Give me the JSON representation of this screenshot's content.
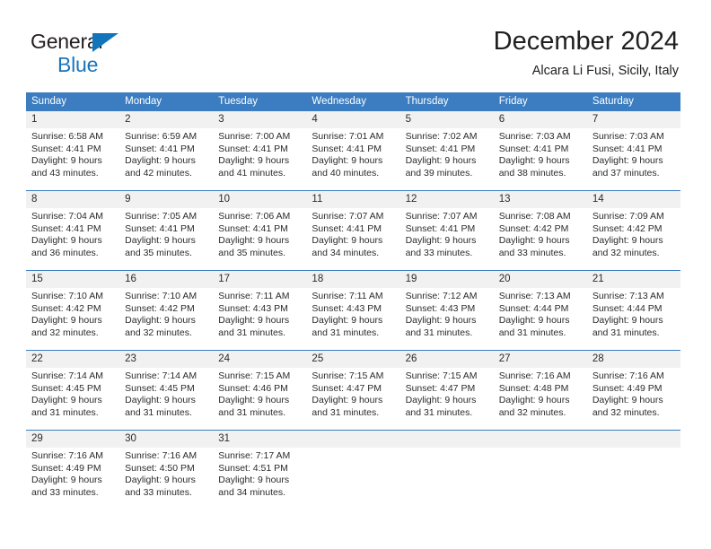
{
  "brand": {
    "name_part1": "General",
    "name_part2": "Blue",
    "color_dark": "#231f20",
    "color_blue": "#1b75bb"
  },
  "header": {
    "title": "December 2024",
    "subtitle": "Alcara Li Fusi, Sicily, Italy"
  },
  "calendar": {
    "accent_color": "#3b7dc0",
    "daynumber_band_color": "#f1f1f1",
    "day_headers": [
      "Sunday",
      "Monday",
      "Tuesday",
      "Wednesday",
      "Thursday",
      "Friday",
      "Saturday"
    ],
    "weeks": [
      {
        "days": [
          {
            "num": "1",
            "sunrise": "Sunrise: 6:58 AM",
            "sunset": "Sunset: 4:41 PM",
            "daylight_line1": "Daylight: 9 hours",
            "daylight_line2": "and 43 minutes."
          },
          {
            "num": "2",
            "sunrise": "Sunrise: 6:59 AM",
            "sunset": "Sunset: 4:41 PM",
            "daylight_line1": "Daylight: 9 hours",
            "daylight_line2": "and 42 minutes."
          },
          {
            "num": "3",
            "sunrise": "Sunrise: 7:00 AM",
            "sunset": "Sunset: 4:41 PM",
            "daylight_line1": "Daylight: 9 hours",
            "daylight_line2": "and 41 minutes."
          },
          {
            "num": "4",
            "sunrise": "Sunrise: 7:01 AM",
            "sunset": "Sunset: 4:41 PM",
            "daylight_line1": "Daylight: 9 hours",
            "daylight_line2": "and 40 minutes."
          },
          {
            "num": "5",
            "sunrise": "Sunrise: 7:02 AM",
            "sunset": "Sunset: 4:41 PM",
            "daylight_line1": "Daylight: 9 hours",
            "daylight_line2": "and 39 minutes."
          },
          {
            "num": "6",
            "sunrise": "Sunrise: 7:03 AM",
            "sunset": "Sunset: 4:41 PM",
            "daylight_line1": "Daylight: 9 hours",
            "daylight_line2": "and 38 minutes."
          },
          {
            "num": "7",
            "sunrise": "Sunrise: 7:03 AM",
            "sunset": "Sunset: 4:41 PM",
            "daylight_line1": "Daylight: 9 hours",
            "daylight_line2": "and 37 minutes."
          }
        ]
      },
      {
        "days": [
          {
            "num": "8",
            "sunrise": "Sunrise: 7:04 AM",
            "sunset": "Sunset: 4:41 PM",
            "daylight_line1": "Daylight: 9 hours",
            "daylight_line2": "and 36 minutes."
          },
          {
            "num": "9",
            "sunrise": "Sunrise: 7:05 AM",
            "sunset": "Sunset: 4:41 PM",
            "daylight_line1": "Daylight: 9 hours",
            "daylight_line2": "and 35 minutes."
          },
          {
            "num": "10",
            "sunrise": "Sunrise: 7:06 AM",
            "sunset": "Sunset: 4:41 PM",
            "daylight_line1": "Daylight: 9 hours",
            "daylight_line2": "and 35 minutes."
          },
          {
            "num": "11",
            "sunrise": "Sunrise: 7:07 AM",
            "sunset": "Sunset: 4:41 PM",
            "daylight_line1": "Daylight: 9 hours",
            "daylight_line2": "and 34 minutes."
          },
          {
            "num": "12",
            "sunrise": "Sunrise: 7:07 AM",
            "sunset": "Sunset: 4:41 PM",
            "daylight_line1": "Daylight: 9 hours",
            "daylight_line2": "and 33 minutes."
          },
          {
            "num": "13",
            "sunrise": "Sunrise: 7:08 AM",
            "sunset": "Sunset: 4:42 PM",
            "daylight_line1": "Daylight: 9 hours",
            "daylight_line2": "and 33 minutes."
          },
          {
            "num": "14",
            "sunrise": "Sunrise: 7:09 AM",
            "sunset": "Sunset: 4:42 PM",
            "daylight_line1": "Daylight: 9 hours",
            "daylight_line2": "and 32 minutes."
          }
        ]
      },
      {
        "days": [
          {
            "num": "15",
            "sunrise": "Sunrise: 7:10 AM",
            "sunset": "Sunset: 4:42 PM",
            "daylight_line1": "Daylight: 9 hours",
            "daylight_line2": "and 32 minutes."
          },
          {
            "num": "16",
            "sunrise": "Sunrise: 7:10 AM",
            "sunset": "Sunset: 4:42 PM",
            "daylight_line1": "Daylight: 9 hours",
            "daylight_line2": "and 32 minutes."
          },
          {
            "num": "17",
            "sunrise": "Sunrise: 7:11 AM",
            "sunset": "Sunset: 4:43 PM",
            "daylight_line1": "Daylight: 9 hours",
            "daylight_line2": "and 31 minutes."
          },
          {
            "num": "18",
            "sunrise": "Sunrise: 7:11 AM",
            "sunset": "Sunset: 4:43 PM",
            "daylight_line1": "Daylight: 9 hours",
            "daylight_line2": "and 31 minutes."
          },
          {
            "num": "19",
            "sunrise": "Sunrise: 7:12 AM",
            "sunset": "Sunset: 4:43 PM",
            "daylight_line1": "Daylight: 9 hours",
            "daylight_line2": "and 31 minutes."
          },
          {
            "num": "20",
            "sunrise": "Sunrise: 7:13 AM",
            "sunset": "Sunset: 4:44 PM",
            "daylight_line1": "Daylight: 9 hours",
            "daylight_line2": "and 31 minutes."
          },
          {
            "num": "21",
            "sunrise": "Sunrise: 7:13 AM",
            "sunset": "Sunset: 4:44 PM",
            "daylight_line1": "Daylight: 9 hours",
            "daylight_line2": "and 31 minutes."
          }
        ]
      },
      {
        "days": [
          {
            "num": "22",
            "sunrise": "Sunrise: 7:14 AM",
            "sunset": "Sunset: 4:45 PM",
            "daylight_line1": "Daylight: 9 hours",
            "daylight_line2": "and 31 minutes."
          },
          {
            "num": "23",
            "sunrise": "Sunrise: 7:14 AM",
            "sunset": "Sunset: 4:45 PM",
            "daylight_line1": "Daylight: 9 hours",
            "daylight_line2": "and 31 minutes."
          },
          {
            "num": "24",
            "sunrise": "Sunrise: 7:15 AM",
            "sunset": "Sunset: 4:46 PM",
            "daylight_line1": "Daylight: 9 hours",
            "daylight_line2": "and 31 minutes."
          },
          {
            "num": "25",
            "sunrise": "Sunrise: 7:15 AM",
            "sunset": "Sunset: 4:47 PM",
            "daylight_line1": "Daylight: 9 hours",
            "daylight_line2": "and 31 minutes."
          },
          {
            "num": "26",
            "sunrise": "Sunrise: 7:15 AM",
            "sunset": "Sunset: 4:47 PM",
            "daylight_line1": "Daylight: 9 hours",
            "daylight_line2": "and 31 minutes."
          },
          {
            "num": "27",
            "sunrise": "Sunrise: 7:16 AM",
            "sunset": "Sunset: 4:48 PM",
            "daylight_line1": "Daylight: 9 hours",
            "daylight_line2": "and 32 minutes."
          },
          {
            "num": "28",
            "sunrise": "Sunrise: 7:16 AM",
            "sunset": "Sunset: 4:49 PM",
            "daylight_line1": "Daylight: 9 hours",
            "daylight_line2": "and 32 minutes."
          }
        ]
      },
      {
        "days": [
          {
            "num": "29",
            "sunrise": "Sunrise: 7:16 AM",
            "sunset": "Sunset: 4:49 PM",
            "daylight_line1": "Daylight: 9 hours",
            "daylight_line2": "and 33 minutes."
          },
          {
            "num": "30",
            "sunrise": "Sunrise: 7:16 AM",
            "sunset": "Sunset: 4:50 PM",
            "daylight_line1": "Daylight: 9 hours",
            "daylight_line2": "and 33 minutes."
          },
          {
            "num": "31",
            "sunrise": "Sunrise: 7:17 AM",
            "sunset": "Sunset: 4:51 PM",
            "daylight_line1": "Daylight: 9 hours",
            "daylight_line2": "and 34 minutes."
          },
          {
            "num": "",
            "sunrise": "",
            "sunset": "",
            "daylight_line1": "",
            "daylight_line2": ""
          },
          {
            "num": "",
            "sunrise": "",
            "sunset": "",
            "daylight_line1": "",
            "daylight_line2": ""
          },
          {
            "num": "",
            "sunrise": "",
            "sunset": "",
            "daylight_line1": "",
            "daylight_line2": ""
          },
          {
            "num": "",
            "sunrise": "",
            "sunset": "",
            "daylight_line1": "",
            "daylight_line2": ""
          }
        ]
      }
    ]
  }
}
